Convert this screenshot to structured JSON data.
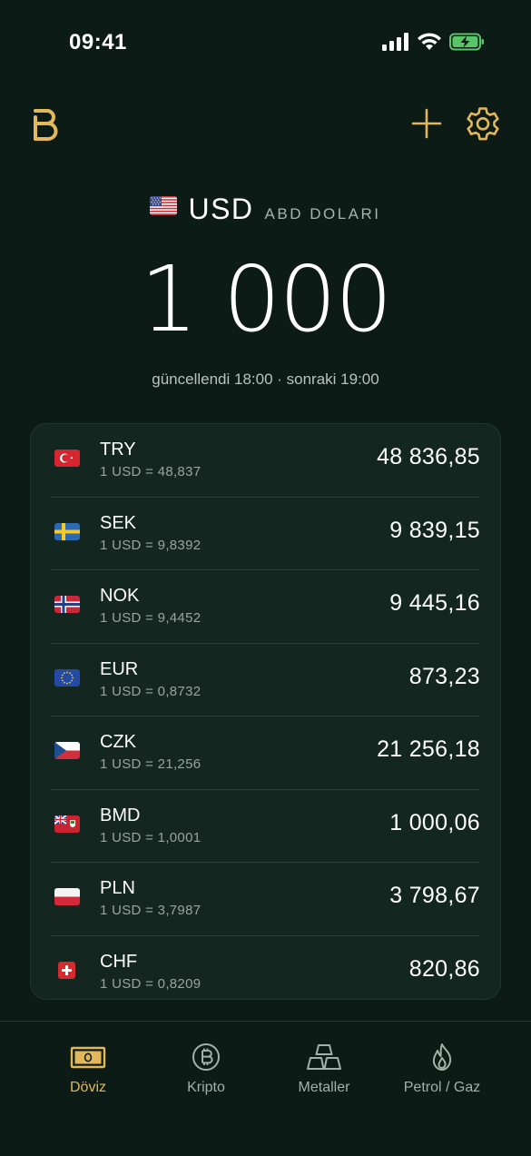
{
  "status_bar": {
    "time": "09:41"
  },
  "header": {
    "logo_icon": "b-logo-icon",
    "add_icon": "plus-icon",
    "settings_icon": "gear-icon",
    "accent_color": "#e2b85a"
  },
  "base": {
    "flag": "us-flag-icon",
    "code": "USD",
    "name": "ABD DOLARI",
    "amount": "1 000",
    "updated": "güncellendi 18:00 · sonraki 19:00"
  },
  "currencies": [
    {
      "code": "TRY",
      "rate": "1 USD = 48,837",
      "value": "48 836,85",
      "flag": "tr-flag-icon"
    },
    {
      "code": "SEK",
      "rate": "1 USD = 9,8392",
      "value": "9 839,15",
      "flag": "se-flag-icon"
    },
    {
      "code": "NOK",
      "rate": "1 USD = 9,4452",
      "value": "9 445,16",
      "flag": "no-flag-icon"
    },
    {
      "code": "EUR",
      "rate": "1 USD = 0,8732",
      "value": "873,23",
      "flag": "eu-flag-icon"
    },
    {
      "code": "CZK",
      "rate": "1 USD = 21,256",
      "value": "21 256,18",
      "flag": "cz-flag-icon"
    },
    {
      "code": "BMD",
      "rate": "1 USD = 1,0001",
      "value": "1 000,06",
      "flag": "bm-flag-icon"
    },
    {
      "code": "PLN",
      "rate": "1 USD = 3,7987",
      "value": "3 798,67",
      "flag": "pl-flag-icon"
    },
    {
      "code": "CHF",
      "rate": "1 USD = 0,8209",
      "value": "820,86",
      "flag": "ch-flag-icon"
    }
  ],
  "tabs": [
    {
      "label": "Döviz",
      "icon": "banknote-icon",
      "active": true
    },
    {
      "label": "Kripto",
      "icon": "bitcoin-icon",
      "active": false
    },
    {
      "label": "Metaller",
      "icon": "gold-bars-icon",
      "active": false
    },
    {
      "label": "Petrol / Gaz",
      "icon": "flame-icon",
      "active": false
    }
  ]
}
